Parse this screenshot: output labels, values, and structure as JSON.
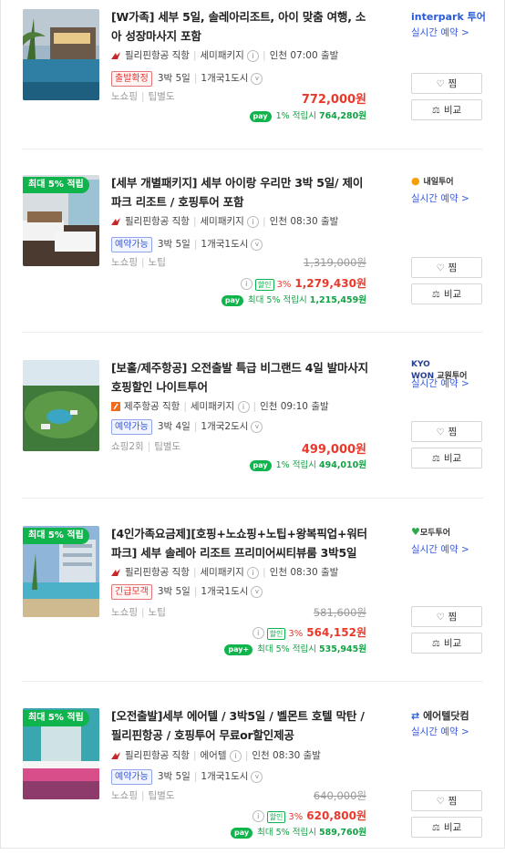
{
  "products": [
    {
      "badge": "",
      "title": "[W가족] 세부 5일, 솔레아리조트, 아이 맞춤 여행, 소아 성장마사지 포함",
      "airline": "필리핀항공 직항",
      "package": "세미패키지",
      "departure": "인천 07:00 출발",
      "status": "출발확정",
      "status_type": "red",
      "duration": "3박 5일",
      "region": "1개국1도시",
      "meta1": "노쇼핑",
      "meta2": "팁별도",
      "original_price": "",
      "discount_pct": "",
      "price": "772,000원",
      "points": "1% 적립시",
      "points_value": "764,280원",
      "seller": "interpark 투어",
      "seller_color": "#2a5bd7",
      "realtime": "실시간 예약 >",
      "wish": "찜",
      "compare": "비교"
    },
    {
      "badge": "최대 5% 적립",
      "title": "[세부 개별패키지] 세부 아이랑 우리만 3박 5일/ 제이파크 리조트 / 호핑투어 포함",
      "airline": "필리핀항공 직항",
      "package": "세미패키지",
      "departure": "인천 08:30 출발",
      "status": "예약가능",
      "status_type": "blue",
      "duration": "3박 5일",
      "region": "1개국1도시",
      "meta1": "노쇼핑",
      "meta2": "노팁",
      "original_price": "1,319,000원",
      "discount_pct": "3%",
      "sale_label": "할인",
      "price": "1,279,430원",
      "points": "최대 5% 적립시",
      "points_value": "1,215,459원",
      "seller": "내일투어",
      "seller_color": "#333333",
      "realtime": "실시간 예약 >",
      "wish": "찜",
      "compare": "비교"
    },
    {
      "badge": "",
      "title": "[보홀/제주항공] 오전출발 특급 비그랜드 4일 발마사지 호핑할인 나이트투어",
      "airline": "제주항공 직항",
      "package": "세미패키지",
      "departure": "인천 09:10 출발",
      "status": "예약가능",
      "status_type": "blue",
      "duration": "3박 4일",
      "region": "1개국2도시",
      "meta1": "쇼핑2회",
      "meta2": "팁별도",
      "original_price": "",
      "discount_pct": "",
      "price": "499,000원",
      "points": "1% 적립시",
      "points_value": "494,010원",
      "seller": "교원투어",
      "seller_color": "#333333",
      "realtime": "실시간 예약 >",
      "wish": "찜",
      "compare": "비교"
    },
    {
      "badge": "최대 5% 적립",
      "title": "[4인가족요금제][호핑+노쇼핑+노팁+왕복픽업+워터파크] 세부 솔레아 리조트 프리미어씨티뷰룸 3박5일",
      "airline": "필리핀항공 직항",
      "package": "세미패키지",
      "departure": "인천 08:30 출발",
      "status": "긴급모객",
      "status_type": "red",
      "duration": "3박 5일",
      "region": "1개국1도시",
      "meta1": "노쇼핑",
      "meta2": "노팁",
      "original_price": "581,600원",
      "discount_pct": "3%",
      "sale_label": "할인",
      "price": "564,152원",
      "points": "최대 5% 적립시",
      "points_value": "535,945원",
      "seller": "모두투어",
      "seller_color": "#333333",
      "realtime": "실시간 예약 >",
      "wish": "찜",
      "compare": "비교"
    },
    {
      "badge": "최대 5% 적립",
      "title": "[오전출발]세부 에어텔 / 3박5일 / 벨몬트 호텔 막탄 / 필리핀항공 / 호핑투어 무료or할인제공",
      "airline": "필리핀항공 직항",
      "package": "에어텔",
      "departure": "인천 08:30 출발",
      "status": "예약가능",
      "status_type": "blue",
      "duration": "3박 5일",
      "region": "1개국1도시",
      "meta1": "노쇼핑",
      "meta2": "팁별도",
      "original_price": "640,000원",
      "discount_pct": "3%",
      "sale_label": "할인",
      "price": "620,800원",
      "points": "최대 5% 적립시",
      "points_value": "589,760원",
      "seller": "에어텔닷컴",
      "seller_color": "#333333",
      "realtime": "실시간 예약 >",
      "wish": "찜",
      "compare": "비교"
    }
  ],
  "npay_label": "pay",
  "info_glyph": "i",
  "chevron_glyph": "v",
  "colors": {
    "price": "#e8392b",
    "point": "#10a243",
    "link": "#3b5bdb",
    "badge": "#10b44c"
  }
}
